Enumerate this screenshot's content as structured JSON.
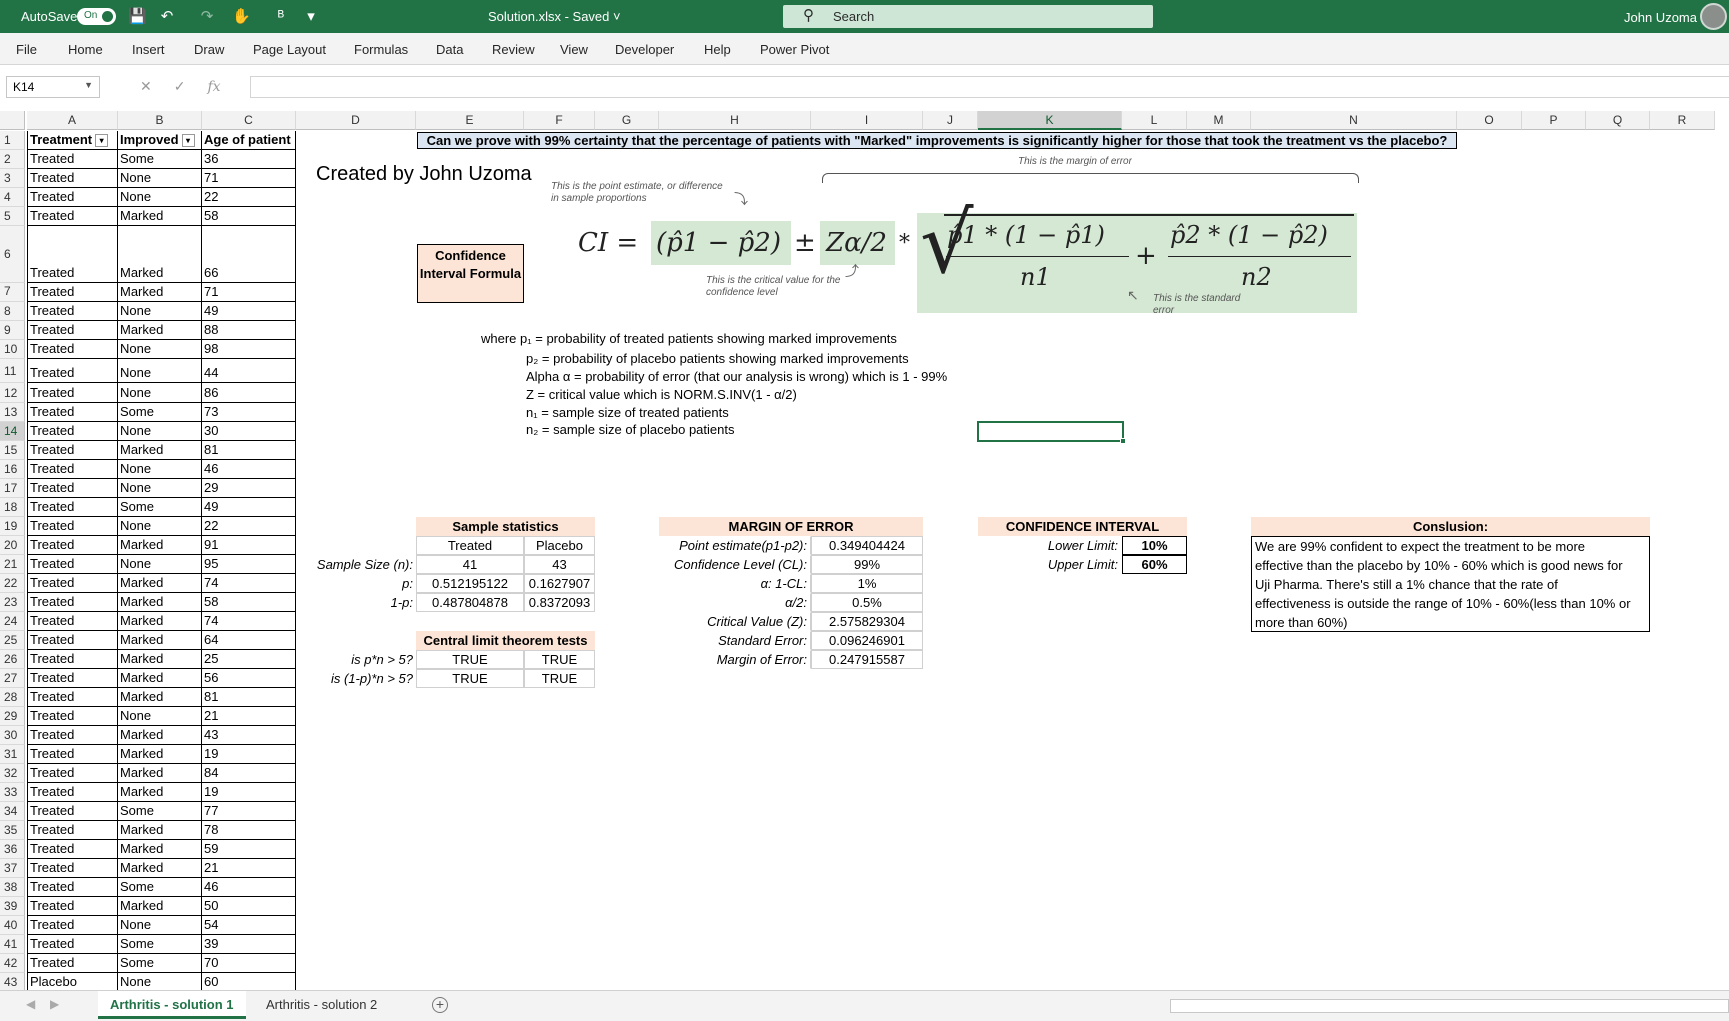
{
  "titlebar": {
    "autosave_label": "AutoSave",
    "autosave_state": "On",
    "doc_title": "Solution.xlsx  -  Saved  ˅",
    "search_placeholder": "Search",
    "user_name": "John Uzoma"
  },
  "ribbon": {
    "tabs": [
      "File",
      "Home",
      "Insert",
      "Draw",
      "Page Layout",
      "Formulas",
      "Data",
      "Review",
      "View",
      "Developer",
      "Help",
      "Power Pivot"
    ]
  },
  "formula_bar": {
    "name_box": "K14",
    "fx": "fx",
    "content": ""
  },
  "columns": [
    "A",
    "B",
    "C",
    "D",
    "E",
    "F",
    "G",
    "H",
    "I",
    "J",
    "K",
    "L",
    "M",
    "N",
    "O",
    "P",
    "Q",
    "R"
  ],
  "rows": [
    "1",
    "2",
    "3",
    "4",
    "5",
    "6",
    "7",
    "8",
    "9",
    "10",
    "11",
    "12",
    "13",
    "14",
    "15",
    "16",
    "17",
    "18",
    "19",
    "20",
    "21",
    "22",
    "23",
    "24",
    "25",
    "26",
    "27",
    "28",
    "29",
    "30",
    "31",
    "32",
    "33",
    "34",
    "35",
    "36",
    "37",
    "38",
    "39",
    "40",
    "41",
    "42",
    "43"
  ],
  "table": {
    "headers": [
      "Treatment",
      "Improved",
      "Age of patient"
    ],
    "rows": [
      [
        "Treated",
        "Some",
        "36"
      ],
      [
        "Treated",
        "None",
        "71"
      ],
      [
        "Treated",
        "None",
        "22"
      ],
      [
        "Treated",
        "Marked",
        "58"
      ],
      [
        "Treated",
        "Marked",
        "66"
      ],
      [
        "Treated",
        "Marked",
        "71"
      ],
      [
        "Treated",
        "None",
        "49"
      ],
      [
        "Treated",
        "Marked",
        "88"
      ],
      [
        "Treated",
        "None",
        "98"
      ],
      [
        "Treated",
        "None",
        "44"
      ],
      [
        "Treated",
        "None",
        "86"
      ],
      [
        "Treated",
        "Some",
        "73"
      ],
      [
        "Treated",
        "None",
        "30"
      ],
      [
        "Treated",
        "Marked",
        "81"
      ],
      [
        "Treated",
        "None",
        "46"
      ],
      [
        "Treated",
        "None",
        "29"
      ],
      [
        "Treated",
        "Some",
        "49"
      ],
      [
        "Treated",
        "None",
        "22"
      ],
      [
        "Treated",
        "Marked",
        "91"
      ],
      [
        "Treated",
        "None",
        "95"
      ],
      [
        "Treated",
        "Marked",
        "74"
      ],
      [
        "Treated",
        "Marked",
        "58"
      ],
      [
        "Treated",
        "Marked",
        "74"
      ],
      [
        "Treated",
        "Marked",
        "64"
      ],
      [
        "Treated",
        "Marked",
        "25"
      ],
      [
        "Treated",
        "Marked",
        "56"
      ],
      [
        "Treated",
        "Marked",
        "81"
      ],
      [
        "Treated",
        "None",
        "21"
      ],
      [
        "Treated",
        "Marked",
        "43"
      ],
      [
        "Treated",
        "Marked",
        "19"
      ],
      [
        "Treated",
        "Marked",
        "84"
      ],
      [
        "Treated",
        "Marked",
        "19"
      ],
      [
        "Treated",
        "Some",
        "77"
      ],
      [
        "Treated",
        "Marked",
        "78"
      ],
      [
        "Treated",
        "Marked",
        "59"
      ],
      [
        "Treated",
        "Marked",
        "21"
      ],
      [
        "Treated",
        "Some",
        "46"
      ],
      [
        "Treated",
        "Marked",
        "50"
      ],
      [
        "Treated",
        "None",
        "54"
      ],
      [
        "Treated",
        "Some",
        "39"
      ],
      [
        "Treated",
        "Some",
        "70"
      ],
      [
        "Placebo",
        "None",
        "60"
      ]
    ]
  },
  "question": "Can we prove with 99% certainty that the percentage of patients with \"Marked\" improvements is significantly higher for those that took the treatment vs the placebo?",
  "created_by": "Created by John Uzoma",
  "formula_label": "Confidence Interval Formula",
  "formula": {
    "ci": "CI =",
    "point": "(p̂1 − p̂2)",
    "pm": "±",
    "z": "Zα/2",
    "mult": "*",
    "plus": "+",
    "term1_num": "p̂1 * (1 − p̂1)",
    "term1_den": "n1",
    "term2_num": "p̂2 * (1 − p̂2)",
    "term2_den": "n2",
    "ann_margin": "This is the margin of error",
    "ann_point": "This is the point estimate, or difference in sample proportions",
    "ann_critical": "This is the critical value for the confidence level",
    "ann_se": "This is the standard error"
  },
  "definitions": [
    "where  p₁ = probability of treated patients showing marked improvements",
    "p₂ = probability of placebo patients showing marked improvements",
    "Alpha α = probability of error (that our analysis is wrong) which is 1 - 99%",
    "Z = critical value which is NORM.S.INV(1 - α/2)",
    "n₁ = sample size of treated patients",
    "n₂ = sample size of placebo patients"
  ],
  "sample_stats": {
    "title": "Sample statistics",
    "col1": "Treated",
    "col2": "Placebo",
    "rows": [
      {
        "label": "Sample Size (n):",
        "v1": "41",
        "v2": "43"
      },
      {
        "label": "p:",
        "v1": "0.512195122",
        "v2": "0.1627907"
      },
      {
        "label": "1-p:",
        "v1": "0.487804878",
        "v2": "0.8372093"
      }
    ]
  },
  "clt": {
    "title": "Central limit theorem tests",
    "rows": [
      {
        "label": "is p*n > 5?",
        "v1": "TRUE",
        "v2": "TRUE"
      },
      {
        "label": "is (1-p)*n > 5?",
        "v1": "TRUE",
        "v2": "TRUE"
      }
    ]
  },
  "margin": {
    "title": "MARGIN OF ERROR",
    "rows": [
      {
        "label": "Point estimate(p1-p2):",
        "value": "0.349404424"
      },
      {
        "label": "Confidence Level (CL):",
        "value": "99%"
      },
      {
        "label": "α: 1-CL:",
        "value": "1%"
      },
      {
        "label": "α/2:",
        "value": "0.5%"
      },
      {
        "label": "Critical Value (Z):",
        "value": "2.575829304"
      },
      {
        "label": "Standard Error:",
        "value": "0.096246901"
      },
      {
        "label": "Margin of Error:",
        "value": "0.247915587"
      }
    ]
  },
  "ci": {
    "title": "CONFIDENCE INTERVAL",
    "lower_label": "Lower Limit:",
    "lower": "10%",
    "upper_label": "Upper Limit:",
    "upper": "60%"
  },
  "conclusion": {
    "title": "Conslusion:",
    "lines": [
      "We are 99% confident to expect the treatment to be more",
      "effective than the placebo by 10% - 60%  which is good news for",
      "Uji Pharma. There's still a 1% chance that the rate of",
      "effectiveness is outside the range of 10% - 60%(less than 10% or",
      "more than 60%)"
    ]
  },
  "sheets": [
    "Arthritis - solution 1",
    "Arthritis - solution 2"
  ],
  "colors": {
    "excel_green": "#217346",
    "peach": "#fce4d6",
    "formula_bg": "#d5e8d4"
  }
}
